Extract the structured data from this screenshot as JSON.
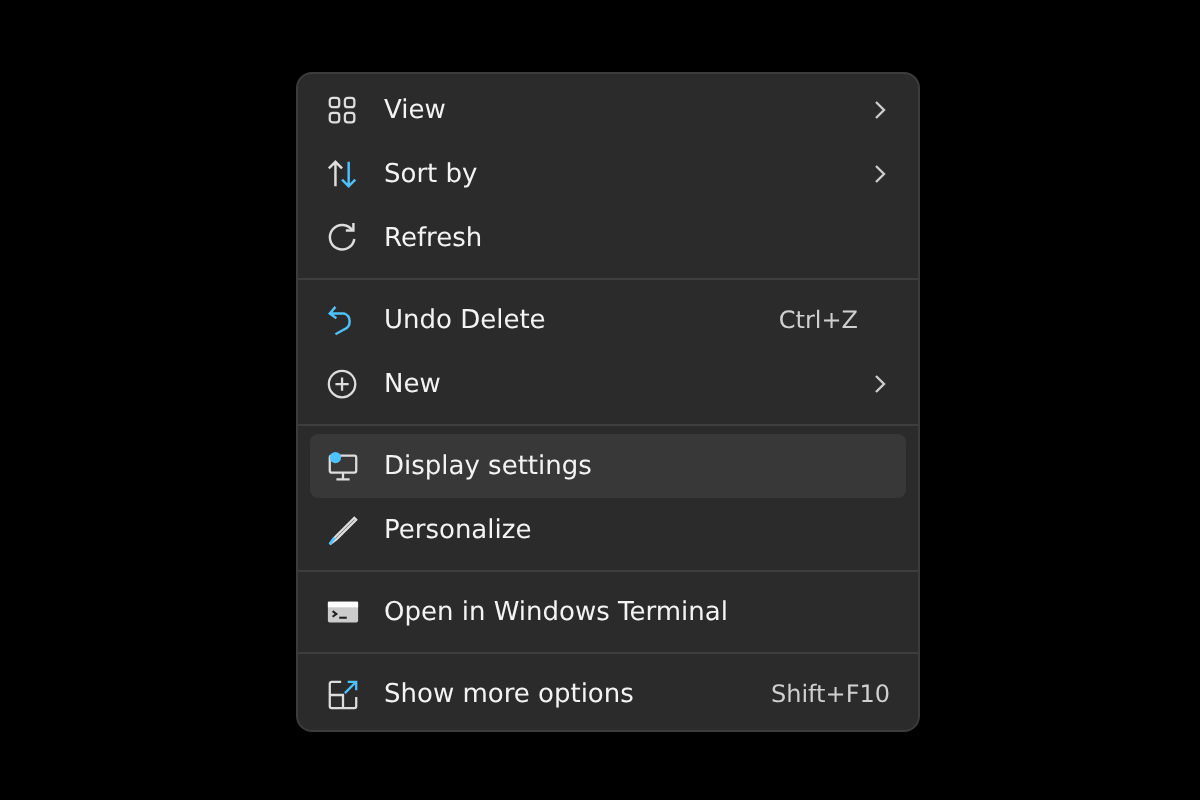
{
  "menu": {
    "groups": [
      [
        {
          "label": "View",
          "submenu": true,
          "selected": false
        },
        {
          "label": "Sort by",
          "submenu": true,
          "selected": false
        },
        {
          "label": "Refresh",
          "submenu": false,
          "selected": false
        }
      ],
      [
        {
          "label": "Undo Delete",
          "shortcut": "Ctrl+Z",
          "submenu": false,
          "selected": false
        },
        {
          "label": "New",
          "submenu": true,
          "selected": false
        }
      ],
      [
        {
          "label": "Display settings",
          "submenu": false,
          "selected": true
        },
        {
          "label": "Personalize",
          "submenu": false,
          "selected": false
        }
      ],
      [
        {
          "label": "Open in Windows Terminal",
          "submenu": false,
          "selected": false
        }
      ],
      [
        {
          "label": "Show more options",
          "shortcut": "Shift+F10",
          "submenu": false,
          "selected": false
        }
      ]
    ]
  }
}
